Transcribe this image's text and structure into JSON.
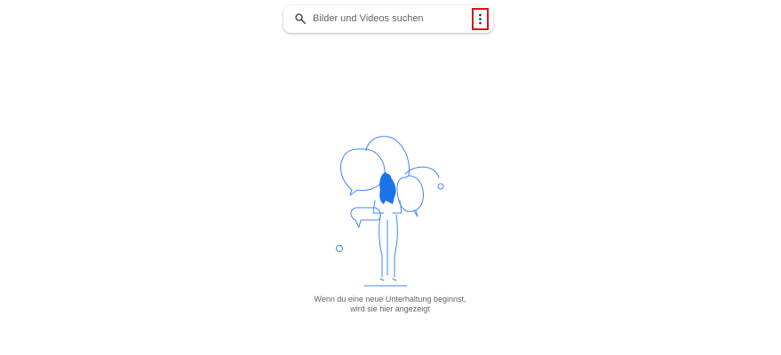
{
  "search": {
    "placeholder": "Bilder und Videos suchen",
    "icon": "search-icon"
  },
  "menu": {
    "icon": "more-vert-icon",
    "highlight_color": "#d01919"
  },
  "empty_state": {
    "line1": "Wenn du eine neue Unterhaltung beginnst,",
    "line2": "wird sie hier angezeigt",
    "illustration": "person-with-speech-bubbles-illustration"
  },
  "colors": {
    "accent": "#1a73e8",
    "illustration_line": "#4285f4",
    "text_secondary": "#5f6368"
  }
}
